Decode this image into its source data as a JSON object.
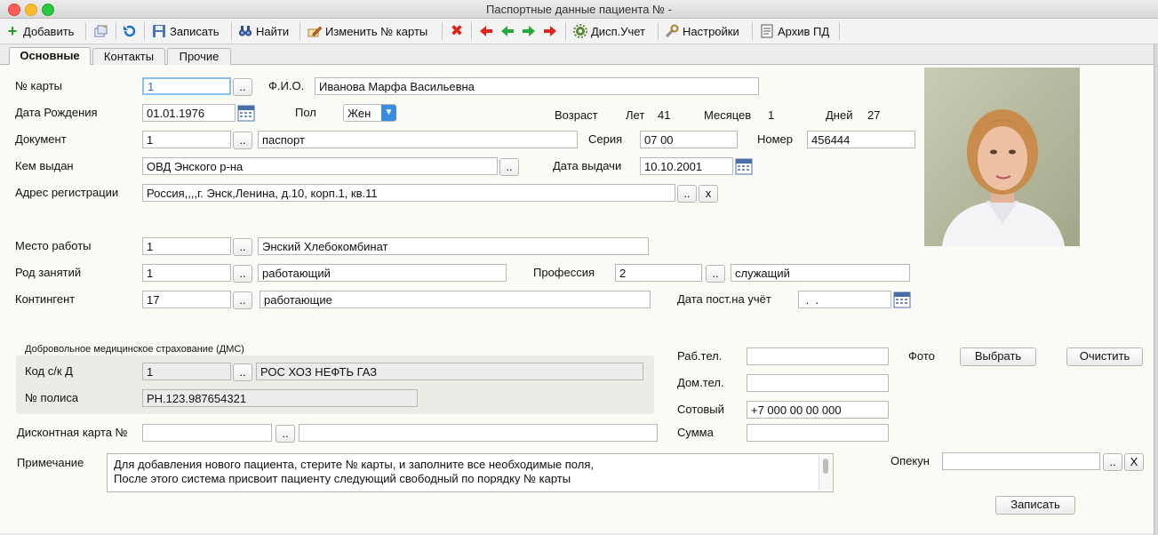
{
  "window": {
    "title": "Паспортные данные пациента №  -"
  },
  "toolbar": {
    "add": "Добавить",
    "save": "Записать",
    "find": "Найти",
    "change_card": "Изменить № карты",
    "disp": "Дисп.Учет",
    "settings": "Настройки",
    "archive": "Архив ПД"
  },
  "tabs": [
    "Основные",
    "Контакты",
    "Прочие"
  ],
  "form": {
    "card_no_label": "№ карты",
    "card_no": "1",
    "fio_label": "Ф.И.О.",
    "fio": "Иванова Марфа Васильевна",
    "dob_label": "Дата Рождения",
    "dob": "01.01.1976",
    "sex_label": "Пол",
    "sex": "Жен",
    "age_label": "Возраст",
    "years_label": "Лет",
    "years": "41",
    "months_label": "Месяцев",
    "months": "1",
    "days_label": "Дней",
    "days": "27",
    "doc_label": "Документ",
    "doc_code": "1",
    "doc_name": "паспорт",
    "series_label": "Серия",
    "series": "07 00",
    "number_label": "Номер",
    "number": "456444",
    "issued_by_label": "Кем выдан",
    "issued_by": "ОВД Энского р-на",
    "issue_date_label": "Дата выдачи",
    "issue_date": "10.10.2001",
    "address_label": "Адрес регистрации",
    "address": "Россия,,,,г. Энск,Ленина, д.10, корп.1, кв.11",
    "work_label": "Место работы",
    "work_code": "1",
    "work_name": "Энский Хлебокомбинат",
    "occupation_label": "Род занятий",
    "occupation_code": "1",
    "occupation_name": "работающий",
    "profession_label": "Профессия",
    "profession_code": "2",
    "profession_name": "служащий",
    "contingent_label": "Контингент",
    "contingent_code": "17",
    "contingent_name": "работающие",
    "reg_date_label": "Дата пост.на учёт",
    "reg_date": " .  .",
    "dms_title": "Добровольное медицинское страхование (ДМС)",
    "insurer_label": "Код с/к Д",
    "insurer_code": "1",
    "insurer_name": "РОС ХОЗ НЕФТЬ ГАЗ",
    "policy_label": "№ полиса",
    "policy": "PH.123.987654321",
    "discount_label": "Дисконтная карта №",
    "discount_code": "",
    "discount_name": "",
    "notes_label": "Примечание",
    "notes_line1": "Для добавления нового пациента, стерите № карты, и заполните все необходимые поля,",
    "notes_line2": "После этого система присвоит пациенту следующий свободный по порядку № карты",
    "work_phone_label": "Раб.тел.",
    "work_phone": "",
    "home_phone_label": "Дом.тел.",
    "home_phone": "",
    "mobile_label": "Сотовый",
    "mobile": "+7 000 00 00 000",
    "sum_label": "Сумма",
    "sum": "",
    "photo_label": "Фото",
    "choose_btn": "Выбрать",
    "clear_btn": "Очистить",
    "guardian_label": "Опекун",
    "guardian": "",
    "save_btn": "Записать",
    "dots": "..",
    "x_small": "x",
    "x_big": "X"
  },
  "colors": {
    "panel_bg": "#fbfbf6",
    "accent_blue": "#3b8be0"
  }
}
